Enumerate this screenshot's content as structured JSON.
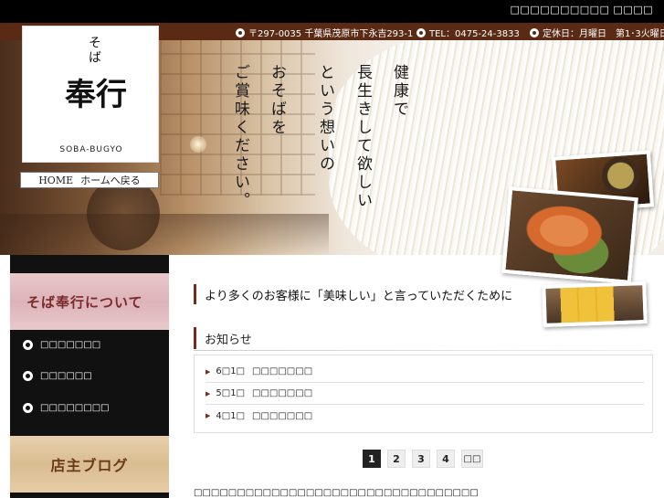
{
  "header": {
    "top_link": "□□□□□□□□□□ □□□□",
    "postal": "〒297-0035 千葉県茂原市下永吉293-1",
    "tel": "TEL：0475-24-3833",
    "closed": "定休日：月曜日　第1･3火曜日"
  },
  "logo": {
    "soba": "そば",
    "name": "奉行",
    "roman": "SOBA-BUGYO"
  },
  "homebar": {
    "home": "HOME",
    "back": "ホームへ戻る"
  },
  "hero": {
    "lines": [
      "健康で",
      "長生きして欲しい",
      "という想いの",
      "おそばを",
      "ご賞味ください。"
    ]
  },
  "sidebar": {
    "about_banner": "そば奉行について",
    "items": [
      {
        "label": "□□□□□□□"
      },
      {
        "label": "□□□□□□"
      },
      {
        "label": "□□□□□□□□"
      }
    ],
    "blog_banner": "店主ブログ"
  },
  "main": {
    "tagline": "より多くのお客様に「美味しい」と言っていただくために",
    "news_title": "お知らせ",
    "news": [
      {
        "date": "6□1□",
        "text": "□□□□□□□"
      },
      {
        "date": "5□1□",
        "text": "□□□□□□□"
      },
      {
        "date": "4□1□",
        "text": "□□□□□□□"
      }
    ],
    "pagination": {
      "pages": [
        "1",
        "2",
        "3",
        "4"
      ],
      "active": "1",
      "next": "□□"
    },
    "footer_text": "□□□□□□□□□□□□□□□□□□□□□□□□□□□□□□□□□"
  }
}
